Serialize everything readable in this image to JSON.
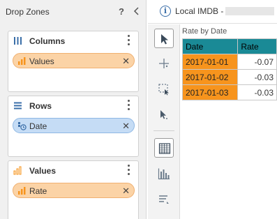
{
  "left_panel": {
    "title": "Drop Zones",
    "help_glyph": "?",
    "zones": [
      {
        "title": "Columns",
        "icon": "columns-icon",
        "chips": [
          {
            "label": "Values",
            "icon": "bar-chart-icon",
            "color": "orange"
          }
        ]
      },
      {
        "title": "Rows",
        "icon": "rows-icon",
        "chips": [
          {
            "label": "Date",
            "icon": "date-hierarchy-icon",
            "color": "blue"
          }
        ]
      },
      {
        "title": "Values",
        "icon": "values-icon",
        "chips": [
          {
            "label": "Rate",
            "icon": "bar-chart-icon",
            "color": "orange"
          }
        ]
      }
    ]
  },
  "top_bar": {
    "info_glyph": "i",
    "datasource": "Local IMDB -"
  },
  "toolbar": {
    "tools": [
      "select-arrow-icon",
      "crosshair-icon",
      "marquee-select-icon",
      "drill-icon",
      "table-view-icon",
      "chart-view-icon",
      "sort-icon"
    ],
    "active": [
      "select-arrow-icon",
      "table-view-icon"
    ]
  },
  "table": {
    "title": "Rate by Date",
    "columns": [
      "Date",
      "Rate"
    ],
    "rows": [
      {
        "date": "2017-01-01",
        "rate": "-0.07"
      },
      {
        "date": "2017-01-02",
        "rate": "-0.03"
      },
      {
        "date": "2017-01-03",
        "rate": "-0.03"
      }
    ]
  },
  "colors": {
    "header_teal": "#1a8a96",
    "date_cell_orange": "#f7941d",
    "chip_orange": "#fbd3a6",
    "chip_blue": "#c5dcf5",
    "accent_blue": "#3a6ea8"
  }
}
